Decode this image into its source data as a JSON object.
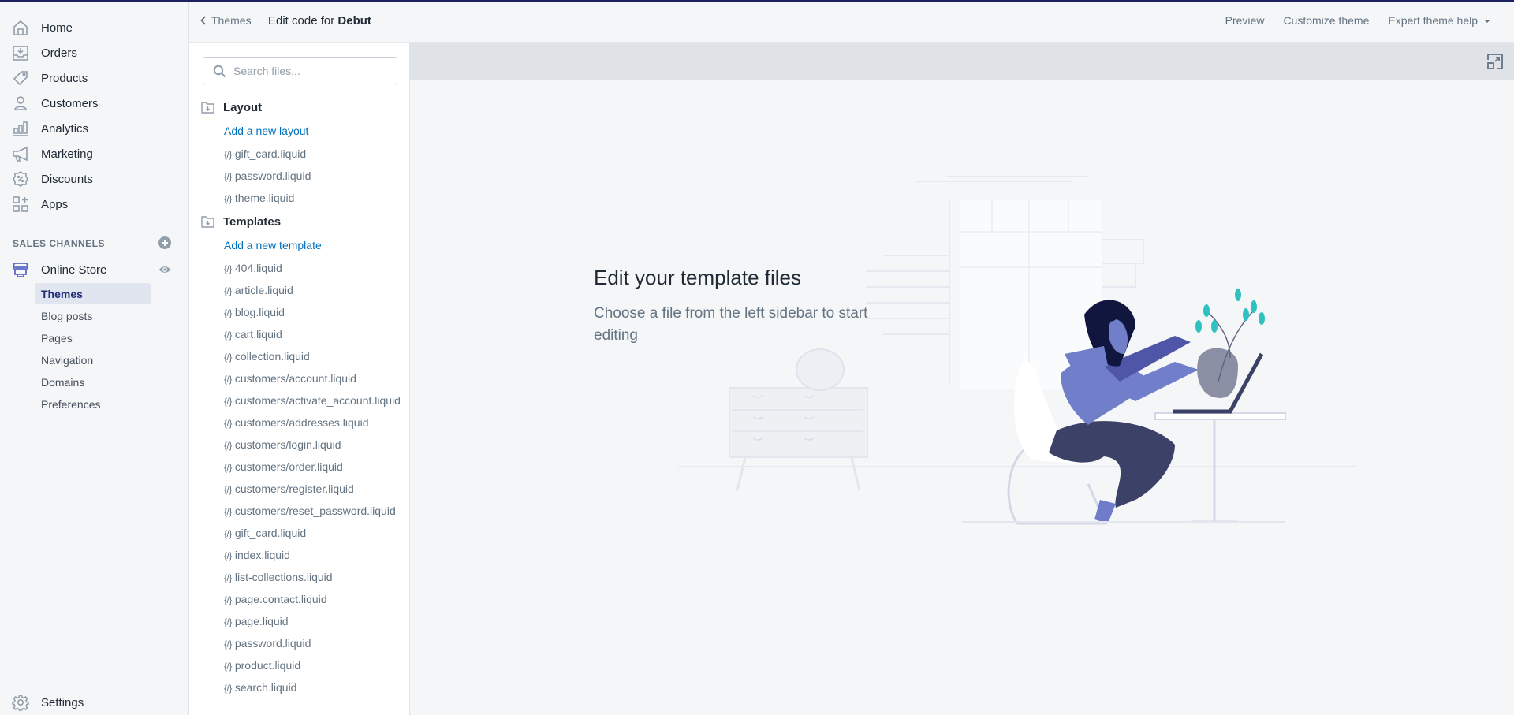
{
  "nav": {
    "items": [
      {
        "label": "Home",
        "icon": "home-icon"
      },
      {
        "label": "Orders",
        "icon": "orders-icon"
      },
      {
        "label": "Products",
        "icon": "tag-icon"
      },
      {
        "label": "Customers",
        "icon": "person-icon"
      },
      {
        "label": "Analytics",
        "icon": "bar-chart-icon"
      },
      {
        "label": "Marketing",
        "icon": "megaphone-icon"
      },
      {
        "label": "Discounts",
        "icon": "discount-icon"
      },
      {
        "label": "Apps",
        "icon": "apps-icon"
      }
    ],
    "sales_channels_header": "SALES CHANNELS",
    "online_store": "Online Store",
    "sub_items": [
      "Themes",
      "Blog posts",
      "Pages",
      "Navigation",
      "Domains",
      "Preferences"
    ],
    "active_sub_item": "Themes",
    "settings": "Settings",
    "accent_color": "#5c6ac4"
  },
  "topbar": {
    "back_label": "Themes",
    "title_prefix": "Edit code for",
    "theme_name": "Debut",
    "actions": {
      "preview": "Preview",
      "customize": "Customize theme",
      "expert_help": "Expert theme help"
    }
  },
  "files": {
    "search_placeholder": "Search files...",
    "sections": [
      {
        "title": "Layout",
        "add_link": "Add a new layout",
        "files": [
          "gift_card.liquid",
          "password.liquid",
          "theme.liquid"
        ]
      },
      {
        "title": "Templates",
        "add_link": "Add a new template",
        "files": [
          "404.liquid",
          "article.liquid",
          "blog.liquid",
          "cart.liquid",
          "collection.liquid",
          "customers/account.liquid",
          "customers/activate_account.liquid",
          "customers/addresses.liquid",
          "customers/login.liquid",
          "customers/order.liquid",
          "customers/register.liquid",
          "customers/reset_password.liquid",
          "gift_card.liquid",
          "index.liquid",
          "list-collections.liquid",
          "page.contact.liquid",
          "page.liquid",
          "password.liquid",
          "product.liquid",
          "search.liquid"
        ]
      }
    ],
    "file_prefix": "{/}",
    "link_color": "#006fbb"
  },
  "main": {
    "empty_title": "Edit your template files",
    "empty_subtitle": "Choose a file from the left sidebar to start editing"
  }
}
